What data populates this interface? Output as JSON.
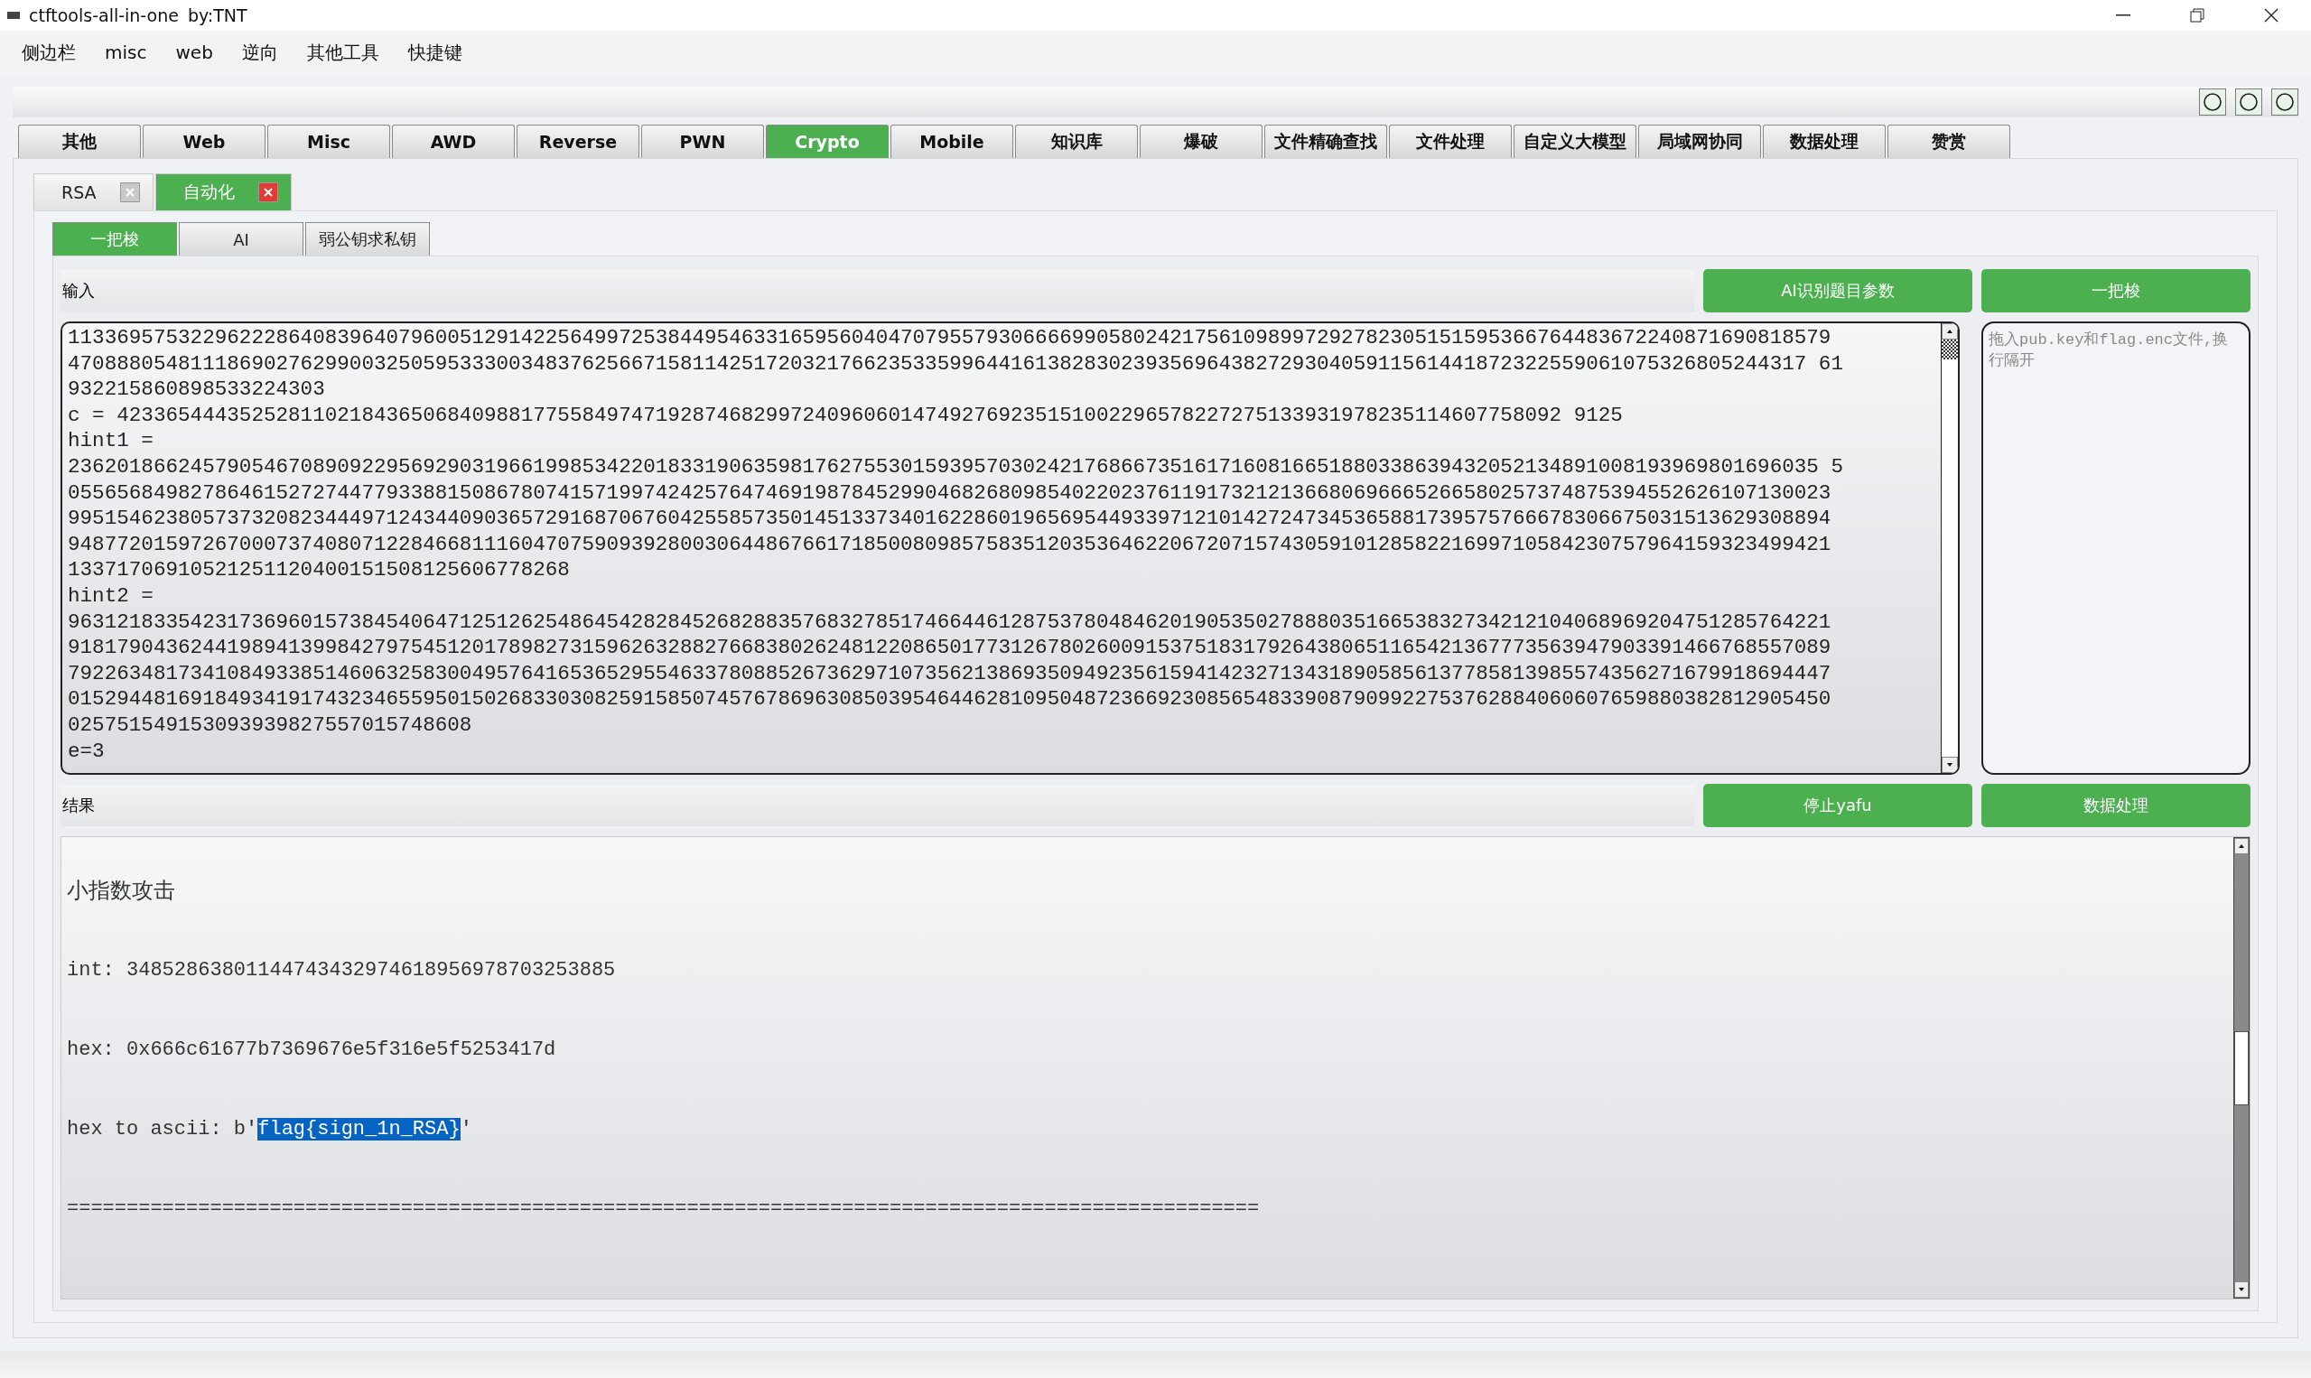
{
  "window": {
    "title": "ctftools-all-in-one",
    "author": "by:TNT"
  },
  "menu": [
    "侧边栏",
    "misc",
    "web",
    "逆向",
    "其他工具",
    "快捷键"
  ],
  "main_tabs": [
    {
      "label": "其他",
      "selected": false
    },
    {
      "label": "Web",
      "selected": false
    },
    {
      "label": "Misc",
      "selected": false
    },
    {
      "label": "AWD",
      "selected": false
    },
    {
      "label": "Reverse",
      "selected": false
    },
    {
      "label": "PWN",
      "selected": false
    },
    {
      "label": "Crypto",
      "selected": true
    },
    {
      "label": "Mobile",
      "selected": false
    },
    {
      "label": "知识库",
      "selected": false
    },
    {
      "label": "爆破",
      "selected": false
    },
    {
      "label": "文件精确查找",
      "selected": false
    },
    {
      "label": "文件处理",
      "selected": false
    },
    {
      "label": "自定义大模型",
      "selected": false
    },
    {
      "label": "局域网协同",
      "selected": false
    },
    {
      "label": "数据处理",
      "selected": false
    },
    {
      "label": "赞赏",
      "selected": false
    }
  ],
  "sub_tabs": [
    {
      "label": "RSA",
      "selected": false
    },
    {
      "label": "自动化",
      "selected": true
    }
  ],
  "tool_tabs": [
    {
      "label": "一把梭",
      "selected": true
    },
    {
      "label": "AI",
      "selected": false
    },
    {
      "label": "弱公钥求私钥",
      "selected": false
    }
  ],
  "input": {
    "label": "输入",
    "buttons": [
      "AI识别题目参数",
      "一把梭"
    ],
    "lines": [
      "113369575322962228640839640796005129142256499725384495463316595604047079557930666699058024217561098997292782305151595366764483672240871690818579",
      "4708880548111869027629900325059533300348376256671581142517203217662353359964416138283023935696438272930405911561441872322559061075326805244317 61",
      "932215860898533224303",
      "c = 4233654443525281102184365068409881775584974719287468299724096060147492769235151002296578227275133931978235114607758092 9125",
      "hint1 =",
      "23620186624579054670890922956929031966199853422018331906359817627553015939570302421768667351617160816651880338639432052134891008193969801696035 5",
      "055656849827864615272744779338815086780741571997424257647469198784529904682680985402202376119173212136680696665266580257374875394552626107130023",
      "995154623805737320823444971243440903657291687067604255857350145133734016228601965695449339712101427247345365881739575766678306675031513629308894",
      "948772015972670007374080712284668111604707590939280030644867661718500809857583512035364622067207157430591012858221699710584230757964159323499421",
      "13371706910521251120400151508125606778268",
      "hint2 =",
      "963121833542317369601573845406471251262548645428284526828835768327851746644612875378048462019053502788803516653832734212104068969204751285764221",
      "918179043624419894139984279754512017898273159626328827668380262481220865017731267802600915375183179264380651165421367773563947903391466768557089",
      "792263481734108493385146063258300495764165365295546337808852673629710735621386935094923561594142327134318905856137785813985574356271679918694447",
      "015294481691849341917432346559501502683303082591585074576786963085039546446281095048723669230856548339087909922753762884060607659880382812905450",
      "025751549153093939827557015748608",
      "e=3"
    ],
    "file_drop": {
      "placeholder": "拖入pub.key和flag.enc文件,换行隔开"
    }
  },
  "result": {
    "label": "结果",
    "buttons": [
      "停止yafu",
      "数据处理"
    ],
    "lines": [
      {
        "kind": "heading",
        "text": "小指数攻击"
      },
      {
        "kind": "code",
        "text": "int: 34852863801144743432974618956978703253885"
      },
      {
        "kind": "code",
        "text": "hex: 0x666c61677b7369676e5f316e5f5253417d"
      },
      {
        "kind": "code",
        "text": "hex to ascii: b'",
        "selection": "flag{sign_1n_RSA}",
        "after": "'"
      },
      {
        "kind": "code",
        "text": "===================================================================================================="
      }
    ]
  }
}
